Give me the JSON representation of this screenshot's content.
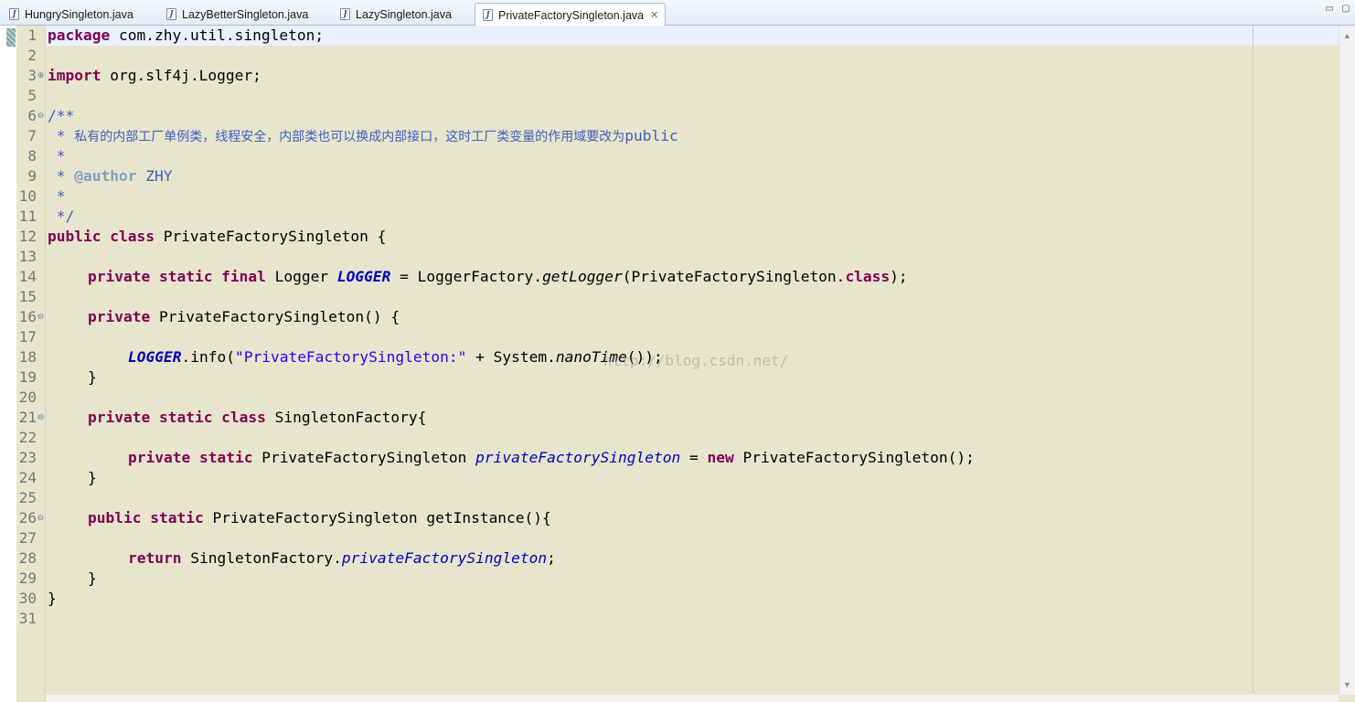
{
  "tabs": [
    {
      "label": "HungrySingleton.java",
      "icon": "java-file-icon"
    },
    {
      "label": "LazyBetterSingleton.java",
      "icon": "java-file-icon"
    },
    {
      "label": "LazySingleton.java",
      "icon": "java-file-icon"
    },
    {
      "label": "PrivateFactorySingleton.java",
      "icon": "java-file-icon",
      "active": true
    }
  ],
  "window_controls": {
    "minimize": "▭",
    "maximize": "▢"
  },
  "colors": {
    "editor_bg": "#e7e5cc",
    "current_line": "#e8f2fe",
    "keyword": "#7f0055",
    "comment": "#3f5fbf",
    "string": "#2a00ff",
    "static_field": "#0000c0"
  },
  "line_numbers": [
    "1",
    "2",
    "3",
    "5",
    "6",
    "7",
    "8",
    "9",
    "10",
    "11",
    "12",
    "13",
    "14",
    "15",
    "16",
    "17",
    "18",
    "19",
    "20",
    "21",
    "22",
    "23",
    "24",
    "25",
    "26",
    "27",
    "28",
    "29",
    "30",
    "31"
  ],
  "fold_markers": {
    "3": "⊕",
    "6": "⊖",
    "16": "⊖",
    "21": "⊖",
    "26": "⊖"
  },
  "code": {
    "l1_kw": "package",
    "l1_rest": " com.zhy.util.singleton;",
    "l3_kw": "import",
    "l3_rest": " org.slf4j.Logger;",
    "l6": "/**",
    "l7_star": " * ",
    "l7_cn": "私有的内部工厂单例类，线程安全，内部类也可以换成内部接口，这时工厂类变量的作用域要改为",
    "l7_en": "public",
    "l8": " *",
    "l9_star": " * ",
    "l9_tag": "@author",
    "l9_rest": " ZHY",
    "l10": " *",
    "l11": " */",
    "l12_kw": "public class",
    "l12_rest": " PrivateFactorySingleton {",
    "l14_kw": "private static final",
    "l14_a": " Logger ",
    "l14_field": "LOGGER",
    "l14_b": " = LoggerFactory.",
    "l14_method": "getLogger",
    "l14_c": "(PrivateFactorySingleton.",
    "l14_kw2": "class",
    "l14_d": ");",
    "l16_kw": "private",
    "l16_rest": " PrivateFactorySingleton() {",
    "l18_field": "LOGGER",
    "l18_a": ".info(",
    "l18_str": "\"PrivateFactorySingleton:\"",
    "l18_b": " + System.",
    "l18_method": "nanoTime",
    "l18_c": "());",
    "l19": "}",
    "l21_kw": "private static class",
    "l21_rest": " SingletonFactory{",
    "l23_kw": "private static",
    "l23_a": " PrivateFactorySingleton ",
    "l23_field": "privateFactorySingleton",
    "l23_b": " = ",
    "l23_kw2": "new",
    "l23_c": " PrivateFactorySingleton();",
    "l24": "}",
    "l26_kw": "public static",
    "l26_rest": " PrivateFactorySingleton getInstance(){",
    "l28_kw": "return",
    "l28_a": " SingletonFactory.",
    "l28_field": "privateFactorySingleton",
    "l28_b": ";",
    "l29": "}",
    "l30": "}"
  },
  "watermark": "http://blog.csdn.net/"
}
